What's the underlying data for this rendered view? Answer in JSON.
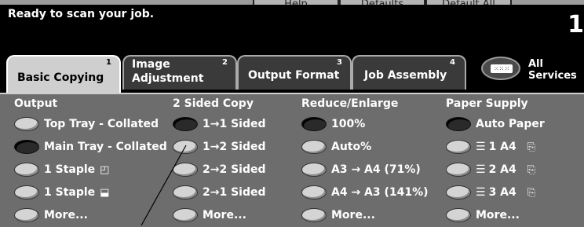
{
  "top_menu": {
    "help": "Help",
    "defaults": "Defaults",
    "default_all": "Default All"
  },
  "status": {
    "message": "Ready to scan your job.",
    "page_indicator": "1"
  },
  "tabs": [
    {
      "label_1": "Basic Copying",
      "label_2": "",
      "num": "1"
    },
    {
      "label_1": "Image",
      "label_2": "Adjustment",
      "num": "2"
    },
    {
      "label_1": "Output Format",
      "label_2": "",
      "num": "3"
    },
    {
      "label_1": "Job Assembly",
      "label_2": "",
      "num": "4"
    }
  ],
  "all_services": {
    "line1": "All",
    "line2": "Services",
    "icon": "keypad-icon"
  },
  "columns": {
    "output": {
      "title": "Output",
      "items": [
        {
          "label": "Top Tray - Collated",
          "selected": false
        },
        {
          "label": "Main Tray - Collated",
          "selected": true
        },
        {
          "label": "1 Staple",
          "selected": false,
          "icon": "◰"
        },
        {
          "label": "1 Staple",
          "selected": false,
          "icon": "⬓"
        },
        {
          "label": "More...",
          "selected": false
        }
      ]
    },
    "sided": {
      "title": "2 Sided Copy",
      "items": [
        {
          "label": "1→1 Sided",
          "selected": true
        },
        {
          "label": "1→2 Sided",
          "selected": false
        },
        {
          "label": "2→2 Sided",
          "selected": false
        },
        {
          "label": "2→1 Sided",
          "selected": false
        },
        {
          "label": "More...",
          "selected": false
        }
      ]
    },
    "reduce": {
      "title": "Reduce/Enlarge",
      "items": [
        {
          "label": "100%",
          "selected": true
        },
        {
          "label": "Auto%",
          "selected": false
        },
        {
          "label": "A3 → A4 (71%)",
          "selected": false
        },
        {
          "label": "A4 → A3 (141%)",
          "selected": false
        },
        {
          "label": "More...",
          "selected": false
        }
      ]
    },
    "paper": {
      "title": "Paper Supply",
      "items": [
        {
          "label": "Auto Paper",
          "selected": true
        },
        {
          "label": "1  A4",
          "selected": false,
          "icon": "⎘"
        },
        {
          "label": "2  A4",
          "selected": false,
          "icon": "⎘"
        },
        {
          "label": "3  A4",
          "selected": false,
          "icon": "⎘"
        },
        {
          "label": "More...",
          "selected": false
        }
      ]
    }
  }
}
